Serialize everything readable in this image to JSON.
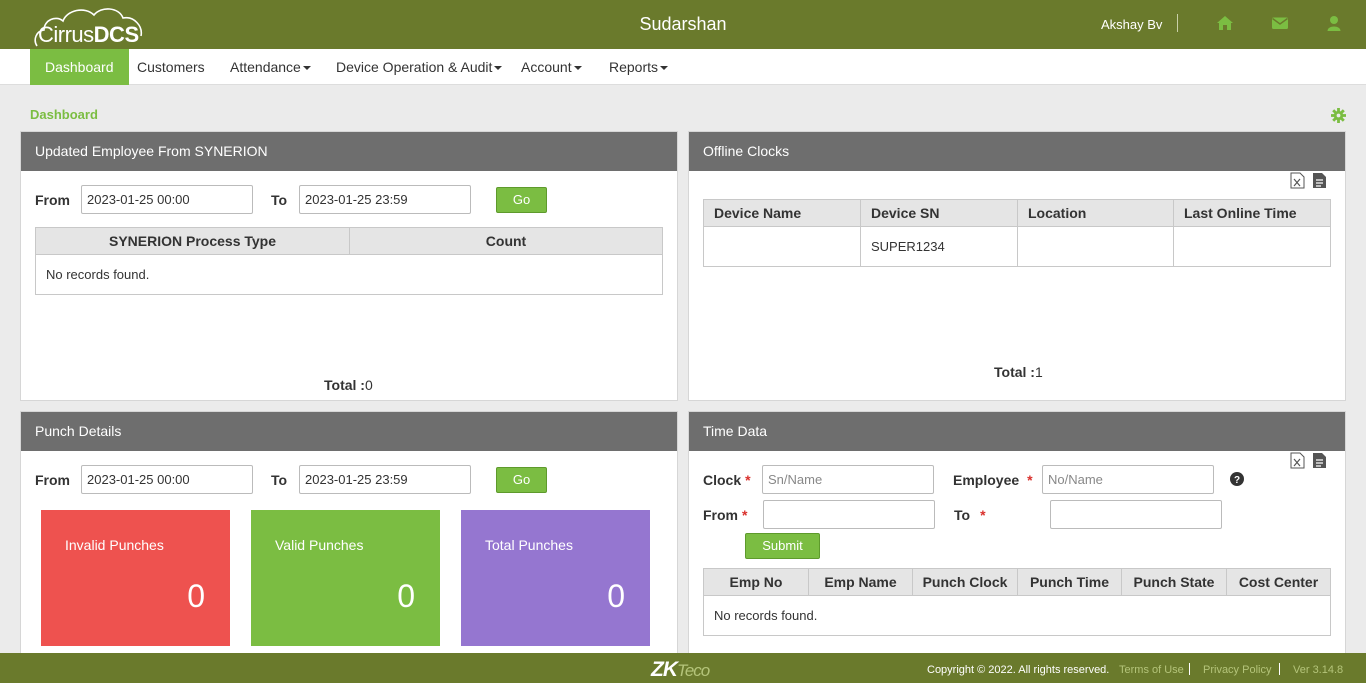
{
  "header": {
    "logo_text_a": "Cirrus",
    "logo_text_b": "DCS",
    "title": "Sudarshan",
    "user": "Akshay Bv",
    "icons": [
      "home-icon",
      "envelope-icon",
      "user-icon"
    ]
  },
  "nav": {
    "items": [
      {
        "label": "Dashboard",
        "active": true,
        "dropdown": false
      },
      {
        "label": "Customers",
        "active": false,
        "dropdown": false
      },
      {
        "label": "Attendance",
        "active": false,
        "dropdown": true
      },
      {
        "label": "Device Operation & Audit",
        "active": false,
        "dropdown": true
      },
      {
        "label": "Account",
        "active": false,
        "dropdown": true
      },
      {
        "label": "Reports",
        "active": false,
        "dropdown": true
      }
    ]
  },
  "breadcrumb": "Dashboard",
  "colors": {
    "header_bg": "#6a7a2c",
    "accent": "#7bbd42",
    "panel_head": "#6e6e6e",
    "invalid_tile": "#ee524f",
    "valid_tile": "#7bbd42",
    "total_tile": "#9576d0"
  },
  "synerion_panel": {
    "title": "Updated Employee From SYNERION",
    "from_label": "From",
    "from_value": "2023-01-25 00:00",
    "to_label": "To",
    "to_value": "2023-01-25 23:59",
    "go": "Go",
    "columns": [
      "SYNERION Process Type",
      "Count"
    ],
    "empty": "No records found.",
    "total_label": "Total :",
    "total_value": "0"
  },
  "offline_panel": {
    "title": "Offline Clocks",
    "columns": [
      "Device Name",
      "Device SN",
      "Location",
      "Last Online Time"
    ],
    "rows": [
      [
        "",
        "SUPER1234",
        "",
        ""
      ]
    ],
    "total_label": "Total :",
    "total_value": "1"
  },
  "punch_panel": {
    "title": "Punch Details",
    "from_label": "From",
    "from_value": "2023-01-25 00:00",
    "to_label": "To",
    "to_value": "2023-01-25 23:59",
    "go": "Go",
    "tiles": [
      {
        "label": "Invalid Punches",
        "value": "0"
      },
      {
        "label": "Valid Punches",
        "value": "0"
      },
      {
        "label": "Total Punches",
        "value": "0"
      }
    ]
  },
  "time_panel": {
    "title": "Time Data",
    "clock_label": "Clock",
    "clock_placeholder": "Sn/Name",
    "employee_label": "Employee",
    "employee_placeholder": "No/Name",
    "from_label": "From",
    "to_label": "To",
    "required_mark": "*",
    "help_icon": "question-circle-icon",
    "submit": "Submit",
    "columns": [
      "Emp No",
      "Emp Name",
      "Punch Clock",
      "Punch Time",
      "Punch State",
      "Cost Center"
    ],
    "empty": "No records found."
  },
  "footer": {
    "brand_a": "ZK",
    "brand_b": "Teco",
    "copyright": "Copyright © 2022. All rights reserved.",
    "terms": "Terms of Use",
    "privacy": "Privacy Policy",
    "version": "Ver 3.14.8"
  }
}
